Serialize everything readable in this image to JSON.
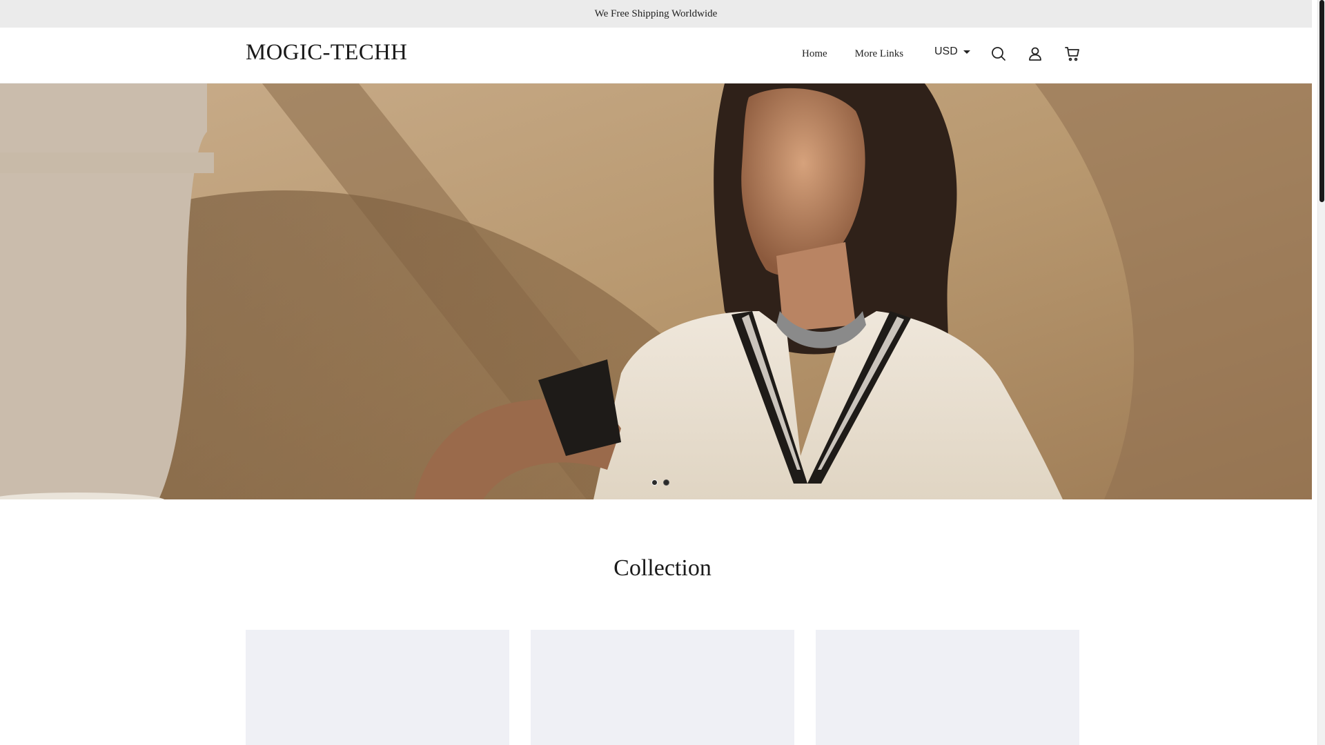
{
  "announcement": {
    "text": "We Free Shipping Worldwide"
  },
  "header": {
    "logo": "MOGIC-TECHH",
    "nav": [
      {
        "label": "Home"
      },
      {
        "label": "More Links"
      }
    ],
    "currency": "USD",
    "icons": [
      "search-icon",
      "account-icon",
      "cart-icon"
    ]
  },
  "hero": {
    "slide_count": 2,
    "active_slide": 2
  },
  "collection": {
    "title": "Collection",
    "card_count": 3
  },
  "colors": {
    "announcement_bg": "#ebebeb",
    "card_bg": "#eff0f5",
    "text": "#222222"
  }
}
